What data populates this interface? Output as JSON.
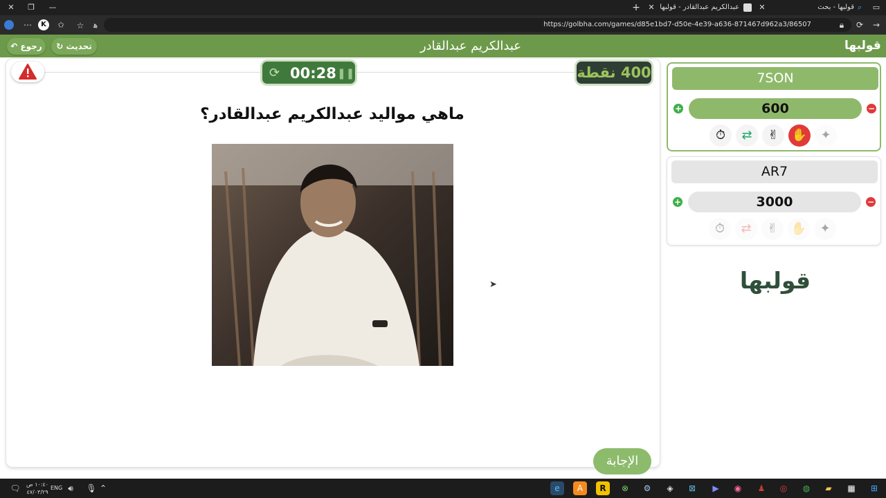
{
  "browser": {
    "window_controls": {
      "close": "✕",
      "restore": "❐",
      "minimize": "—"
    },
    "new_tab": "+",
    "tabs": [
      {
        "label": "عبدالكريم عبدالقادر - قولبها ـ عدل",
        "close": "✕"
      },
      {
        "label": "قولبها - بحث",
        "close": "✕"
      }
    ],
    "url": "https://golbha.com/games/d85e1bd7-d50e-4e39-a636-871467d962a3/86507",
    "address_hint": "ﻫ",
    "more": "⋯"
  },
  "game": {
    "header": {
      "title": "عبدالكريم عبدالقادر",
      "back_label": "رجوع",
      "refresh_label": "تحديث",
      "logo": "قولبها"
    },
    "points": "400 نقطة",
    "timer": "00:28",
    "question": "ماهي مواليد عبدالكريم عبدالقادر؟",
    "answer_button": "الإجابة"
  },
  "teams": [
    {
      "name": "7SON",
      "score": "600",
      "plus": "+",
      "minus": "−",
      "active": true
    },
    {
      "name": "AR7",
      "score": "3000",
      "plus": "+",
      "minus": "−",
      "active": false
    }
  ],
  "helpers": [
    "stopwatch-icon",
    "swap-icon",
    "two-answers-icon",
    "stop-hand-icon",
    "pit-icon"
  ],
  "brand_logo": "قولبها",
  "colors": {
    "header_green": "#6d9a4a",
    "timer_green": "#3f7a3c",
    "points_dark": "#2f3e34",
    "points_text": "#9dc35c",
    "answer_green": "#8dbb6c",
    "active_team": "#8fb96a",
    "inactive_team": "#e5e5e5"
  },
  "taskbar": {
    "language": "ENG",
    "time": "١٠:٤٠ ص",
    "date": "٤٧/٠٣/٢٩"
  }
}
